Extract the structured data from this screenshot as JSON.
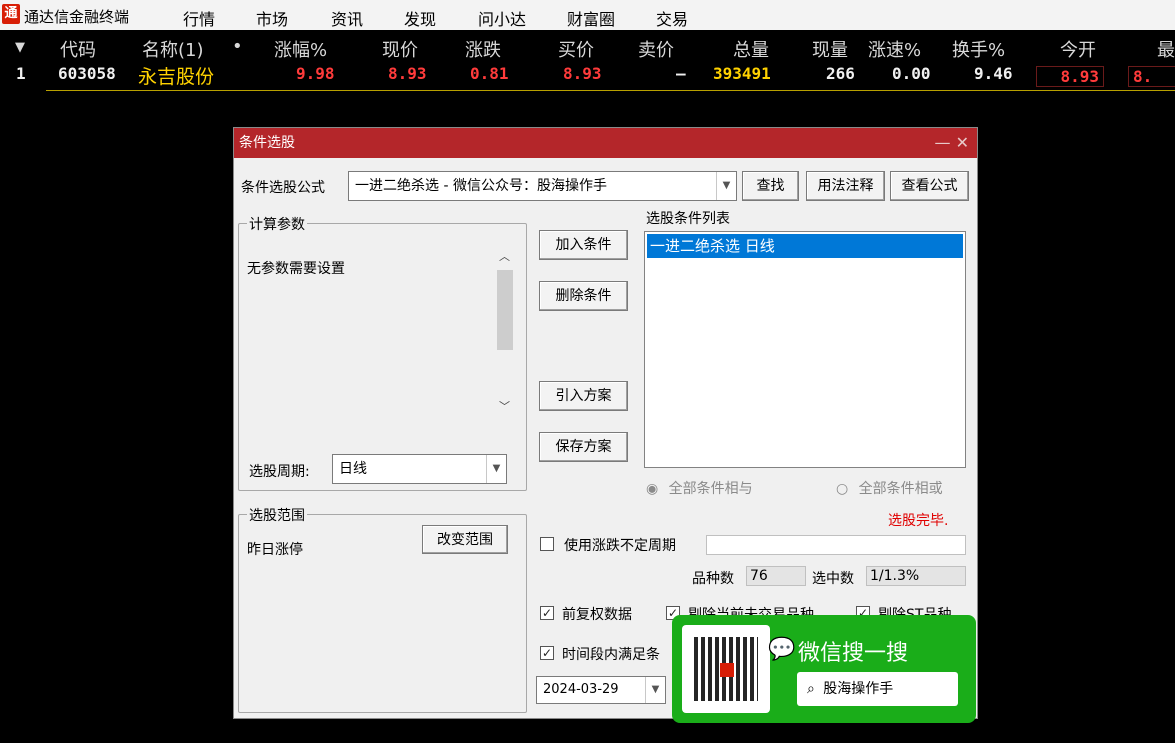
{
  "app": {
    "name": "通达信金融终端",
    "logo": "通",
    "menu": [
      "行情",
      "市场",
      "资讯",
      "发现",
      "问小达",
      "财富圈",
      "交易"
    ]
  },
  "quote": {
    "headers": [
      "▼",
      "代码",
      "名称(1)",
      "•",
      "涨幅%",
      "现价",
      "涨跌",
      "买价",
      "卖价",
      "总量",
      "现量",
      "涨速%",
      "换手%",
      "今开",
      "最"
    ],
    "row": {
      "idx": "1",
      "code": "603058",
      "name": "永吉股份",
      "change_pct": "9.98",
      "price": "8.93",
      "change": "0.81",
      "bid": "8.93",
      "ask": "–",
      "volume": "393491",
      "cur_vol": "266",
      "speed": "0.00",
      "turnover": "9.46",
      "open": "8.93",
      "high": "8."
    },
    "colors": {
      "up": "#ff3b3b",
      "code": "#f0f0f0",
      "name": "#ffd200",
      "volume": "#ffd200",
      "neutral": "#f0f0f0"
    }
  },
  "dialog": {
    "title": "条件选股",
    "controls": "— ✕",
    "formula_label": "条件选股公式",
    "formula_value": "一进二绝杀选 - 微信公众号：股海操作手",
    "btn_find": "查找",
    "btn_usage": "用法注释",
    "btn_view": "查看公式",
    "params_title": "计算参数",
    "params_text": "无参数需要设置",
    "period_label": "选股周期:",
    "period_value": "日线",
    "btn_add": "加入条件",
    "btn_delete": "删除条件",
    "btn_import": "引入方案",
    "btn_save": "保存方案",
    "list_title": "选股条件列表",
    "list_items": [
      "一进二绝杀选  日线"
    ],
    "radio_and": "全部条件相与",
    "radio_or": "全部条件相或",
    "status": "选股完毕.",
    "scope_title": "选股范围",
    "scope_value": "昨日涨停",
    "btn_change_scope": "改变范围",
    "chk_unfixed": "使用涨跌不定周期",
    "count_label": "品种数",
    "count_value": "76",
    "selected_label": "选中数",
    "selected_value": "1/1.3%",
    "chk_adjusted": "前复权数据",
    "chk_remove_untraded": "剔除当前未交易品种",
    "chk_remove_st": "剔除ST品种",
    "chk_time": "时间段内满足条",
    "date_value": "2024-03-29"
  },
  "wechat": {
    "title": "微信搜一搜",
    "search": "股海操作手"
  }
}
